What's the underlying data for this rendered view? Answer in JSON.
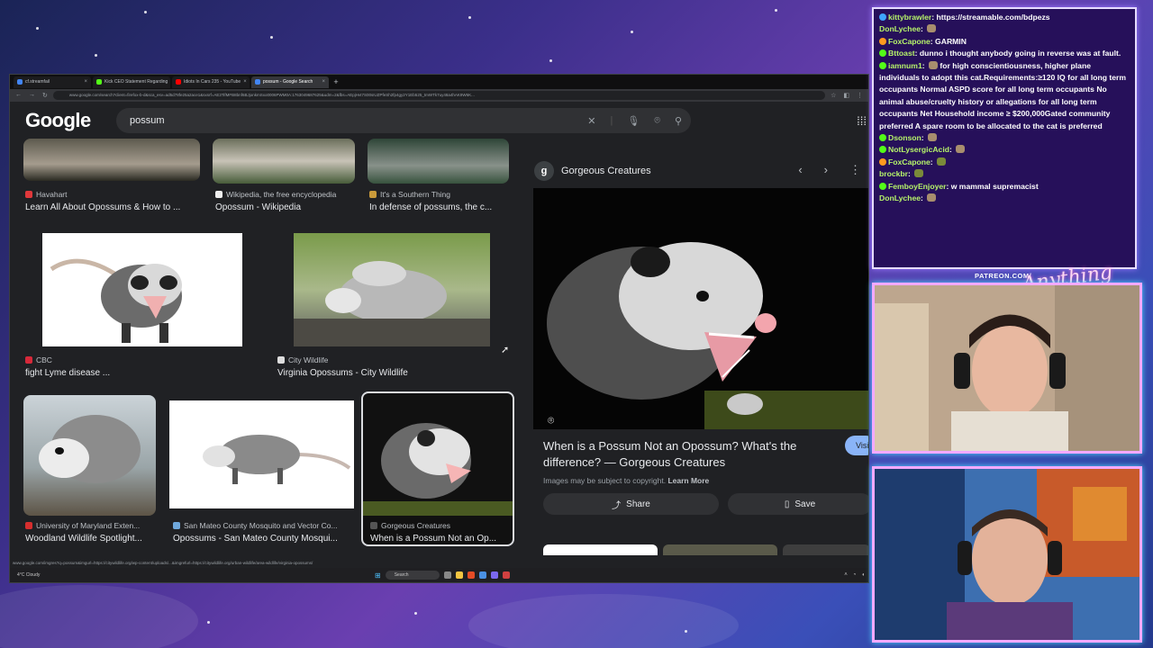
{
  "browser": {
    "tabs": [
      {
        "label": "cf.streamfail",
        "color": "#4285f4"
      },
      {
        "label": "Kick CEO Statement Regarding",
        "color": "#53fc18"
      },
      {
        "label": "Idiots In Cars 235 - YouTube",
        "color": "#ff0000"
      },
      {
        "label": "possum - Google Search",
        "color": "#4285f4",
        "active": true
      }
    ],
    "new_tab": "+",
    "url": "www.google.com/search?client=firefox-b-d&sca_esv=ad5d78fe25a2ace1&sxsrf=AE3TifMFB8bnf6BJjonkmSxo0006PWM0A:1763049687625&udm=2&fbs=AEpjHvt7S00sIUZPfeSh2fp4gy2Y1Eb525_tmWTk7uy48a4hAK9W6K..."
  },
  "google": {
    "logo": "Google",
    "query": "possum"
  },
  "results": [
    {
      "source": "Havahart",
      "title": "Learn All About Opossums & How to ..."
    },
    {
      "source": "Wikipedia, the free encyclopedia",
      "title": "Opossum - Wikipedia"
    },
    {
      "source": "It's a Southern Thing",
      "title": "In defense of possums, the c..."
    },
    {
      "source": "CBC",
      "title": "fight Lyme disease ..."
    },
    {
      "source": "City Wildlife",
      "title": "Virginia Opossums - City Wildlife"
    },
    {
      "source": "University of Maryland Exten...",
      "title": "Woodland Wildlife Spotlight..."
    },
    {
      "source": "San Mateo County Mosquito and Vector Co...",
      "title": "Opossums - San Mateo County Mosqui..."
    },
    {
      "source": "Gorgeous Creatures",
      "title": "When is a Possum Not an Op..."
    }
  ],
  "panel": {
    "site": "Gorgeous Creatures",
    "site_initial": "g",
    "title": "When is a Possum Not an Opossum? What's the difference? — Gorgeous Creatures",
    "copyright": "Images may be subject to copyright.",
    "learn_more": "Learn More",
    "visit": "Visit",
    "share": "Share",
    "save": "Save"
  },
  "status_url": "www.google.com/imgres?q=possum&imgurl=https://citywildlife.org/wp-content/uploads/...&imgrefurl=https://citywildlife.org/urban-wildlife/area-wildlife/virginia-opossums/",
  "taskbar": {
    "weather": "4°C Cloudy",
    "search": "Search"
  },
  "chat": [
    {
      "user": "kittybrawler",
      "text": "https://streamable.com/bdpezs",
      "badge": "#3ea6ff",
      "emote": false
    },
    {
      "user": "DonLychee",
      "text": "",
      "badge": "",
      "emote": true
    },
    {
      "user": "FoxCapone",
      "text": "GARMIN",
      "badge": "#ff9a1f",
      "emote": false
    },
    {
      "user": "Bttoast",
      "text": "dunno i thought anybody going in reverse was at fault.",
      "badge": "#53fc18",
      "emote": false
    },
    {
      "user": "iamnum1",
      "text": "for high conscientiousness, higher plane individuals to adopt this cat.Requirements:≥120 IQ for all long term occupants Normal ASPD score for all long term occupants No animal abuse/cruelty history or allegations for all long term occupants Net Household income ≥ $200,000Gated community preferred A spare room to be allocated to the cat is preferred",
      "badge": "#53fc18",
      "emote": true
    },
    {
      "user": "Dsonson",
      "text": "",
      "badge": "#53fc18",
      "emote": true
    },
    {
      "user": "NotLysergicAcid",
      "text": "",
      "badge": "#53fc18",
      "emote": true
    },
    {
      "user": "FoxCapone",
      "text": "",
      "badge": "#ff9a1f",
      "emote": true
    },
    {
      "user": "brockbr",
      "text": "",
      "badge": "",
      "emote": true
    },
    {
      "user": "FemboyEnjoyer",
      "text": "w mammal supremacist",
      "badge": "#53fc18",
      "emote": false
    },
    {
      "user": "DonLychee",
      "text": "",
      "badge": "",
      "emote": true
    }
  ],
  "overlay": {
    "patreon": "PATREON.COM/",
    "logo": "Anything Else"
  },
  "colors": {
    "google_bg": "#202124",
    "accent_blue": "#8ab4f8",
    "chat_username": "#b6f36a",
    "chat_bg": "#26105a",
    "cam_border": "#f4a9ff"
  }
}
